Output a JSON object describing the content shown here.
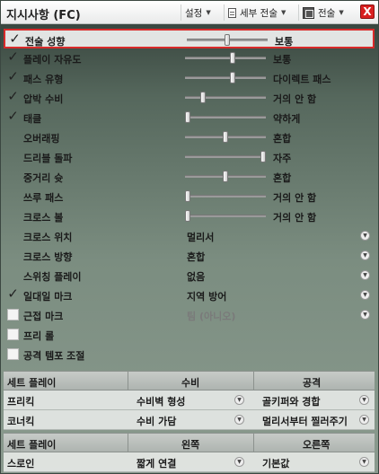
{
  "header": {
    "title": "지시사항 (FC)",
    "settings_label": "설정",
    "detail_tactics_label": "세부 전술",
    "tactics_label": "전술",
    "close_label": "X"
  },
  "slider_rows": [
    {
      "label": "전술 성향",
      "checked": true,
      "value": "보통",
      "level": 0.5
    },
    {
      "label": "플레이 자유도",
      "checked": true,
      "value": "보통",
      "level": 0.6
    },
    {
      "label": "패스 유형",
      "checked": true,
      "value": "다이렉트 패스",
      "level": 0.6
    },
    {
      "label": "압박 수비",
      "checked": true,
      "value": "거의 안 함",
      "level": 0.2
    },
    {
      "label": "태클",
      "checked": true,
      "value": "약하게",
      "level": 0.0
    },
    {
      "label": "오버래핑",
      "checked": null,
      "value": "혼합",
      "level": 0.5
    },
    {
      "label": "드리블 돌파",
      "checked": null,
      "value": "자주",
      "level": 1.0
    },
    {
      "label": "중거리 슛",
      "checked": null,
      "value": "혼합",
      "level": 0.5
    },
    {
      "label": "쓰루 패스",
      "checked": null,
      "value": "거의 안 함",
      "level": 0.0
    },
    {
      "label": "크로스 볼",
      "checked": null,
      "value": "거의 안 함",
      "level": 0.0
    }
  ],
  "dropdown_rows": [
    {
      "label": "크로스 위치",
      "checked": null,
      "value": "멀리서",
      "muted": false
    },
    {
      "label": "크로스 방향",
      "checked": null,
      "value": "혼합",
      "muted": false
    },
    {
      "label": "스위칭 플레이",
      "checked": null,
      "value": "없음",
      "muted": false
    },
    {
      "label": "일대일 마크",
      "checked": true,
      "value": "지역 방어",
      "muted": false
    },
    {
      "label": "근접 마크",
      "checked": false,
      "value": "팀 (아니오)",
      "muted": true
    },
    {
      "label": "프리 롤",
      "checked": false,
      "value": "",
      "muted": false
    },
    {
      "label": "공격 템포 조절",
      "checked": false,
      "value": "",
      "muted": false
    }
  ],
  "setplay1": {
    "headers": [
      "세트 플레이",
      "수비",
      "공격"
    ],
    "rows": [
      {
        "name": "프리킥",
        "defense": "수비벽 형성",
        "attack": "골키퍼와 경합"
      },
      {
        "name": "코너킥",
        "defense": "수비 가담",
        "attack": "멀리서부터 찔러주기"
      }
    ]
  },
  "setplay2": {
    "headers": [
      "세트 플레이",
      "왼쪽",
      "오른쪽"
    ],
    "rows": [
      {
        "name": "스로인",
        "left": "짧게 연결",
        "right": "기본값"
      }
    ]
  }
}
